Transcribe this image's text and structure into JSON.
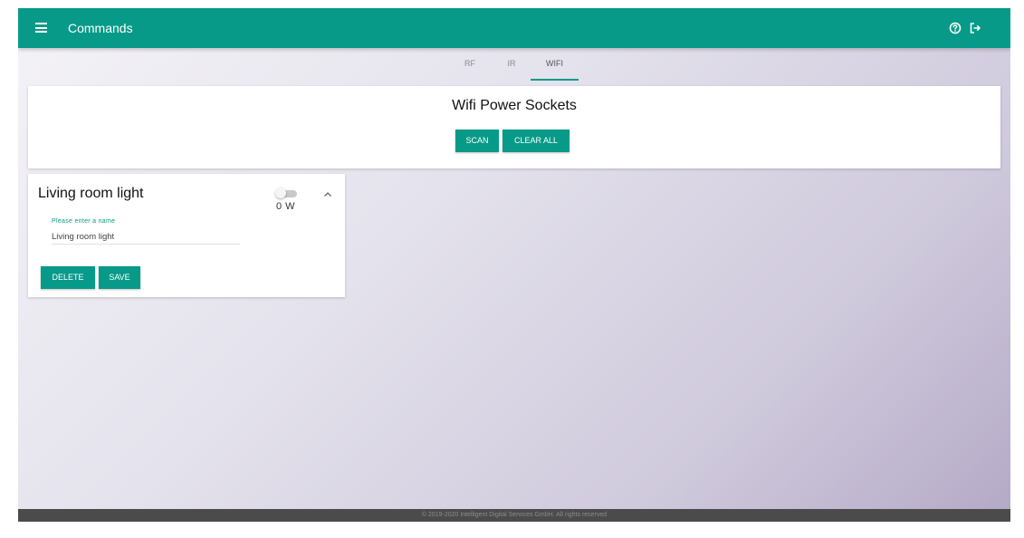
{
  "header": {
    "title": "Commands",
    "icons": [
      "menu-icon",
      "help-icon",
      "logout-icon"
    ],
    "color": "#079a88"
  },
  "tabs": [
    {
      "label": "RF",
      "active": false
    },
    {
      "label": "IR",
      "active": false
    },
    {
      "label": "WIFI",
      "active": true
    }
  ],
  "sockets_panel": {
    "title": "Wifi Power Sockets",
    "scan_label": "SCAN",
    "clear_all_label": "CLEAR ALL"
  },
  "device": {
    "name": "Living room light",
    "power": "0 W",
    "toggle_on": false,
    "name_field_label": "Please enter a name",
    "name_field_value": "Living room light",
    "delete_label": "DELETE",
    "save_label": "SAVE"
  },
  "footer": {
    "text": "© 2019-2020 Intelligent Digital Services GmbH. All rights reserved"
  }
}
